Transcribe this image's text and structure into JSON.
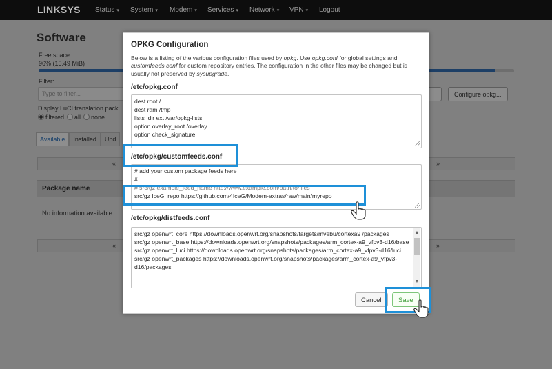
{
  "navbar": {
    "brand": "LINKSYS",
    "items": [
      {
        "label": "Status",
        "caret": "▾"
      },
      {
        "label": "System",
        "caret": "▾"
      },
      {
        "label": "Modem",
        "caret": "▾"
      },
      {
        "label": "Services",
        "caret": "▾"
      },
      {
        "label": "Network",
        "caret": "▾"
      },
      {
        "label": "VPN",
        "caret": "▾"
      },
      {
        "label": "Logout",
        "caret": ""
      }
    ]
  },
  "page": {
    "title": "Software",
    "free_space_label": "Free space:",
    "free_space_value": "96% (15.49 MiB)",
    "free_space_percent": 96,
    "filter_label": "Filter:",
    "filter_placeholder": "Type to filter...",
    "configure_button": "Configure opkg...",
    "display_label": "Display LuCI translation pack",
    "radio_options": [
      "filtered",
      "all",
      "none"
    ],
    "tabs": [
      "Available",
      "Installed",
      "Upd"
    ],
    "pager_prev": "«",
    "pager_next": "»",
    "package_name_header": "Package name",
    "no_info": "No information available"
  },
  "modal": {
    "title": "OPKG Configuration",
    "description": {
      "p1": "Below is a listing of the various configuration files used by ",
      "i1": "opkg",
      "p2": ". Use ",
      "i2": "opkg.conf",
      "p3": " for global settings and ",
      "i3": "customfeeds.conf",
      "p4": " for custom repository entries. The configuration in the other files may be changed but is usually not preserved by ",
      "i4": "sysupgrade",
      "p5": "."
    },
    "sections": [
      {
        "heading": "/etc/opkg.conf",
        "lines": [
          "dest root /",
          "dest ram /tmp",
          "lists_dir ext /var/opkg-lists",
          "option overlay_root /overlay",
          "option check_signature"
        ]
      },
      {
        "heading": "/etc/opkg/customfeeds.conf",
        "lines": [
          "# add your custom package feeds here",
          "#",
          "# src/gz example_feed_name http://www.example.com/path/to/files",
          "src/gz IceG_repo https://github.com/4IceG/Modem-extras/raw/main/myrepo"
        ]
      },
      {
        "heading": "/etc/opkg/distfeeds.conf",
        "lines": [
          "src/gz openwrt_core https://downloads.openwrt.org/snapshots/targets/mvebu/cortexa9 /packages",
          "src/gz openwrt_base https://downloads.openwrt.org/snapshots/packages/arm_cortex-a9_vfpv3-d16/base",
          "src/gz openwrt_luci https://downloads.openwrt.org/snapshots/packages/arm_cortex-a9_vfpv3-d16/luci",
          "src/gz openwrt_packages https://downloads.openwrt.org/snapshots/packages/arm_cortex-a9_vfpv3-d16/packages"
        ]
      }
    ],
    "cancel_label": "Cancel",
    "save_label": "Save"
  },
  "colors": {
    "highlight": "#1e90d8",
    "save_green": "#3a9a34",
    "navbar_bg": "#0d0d0d"
  }
}
